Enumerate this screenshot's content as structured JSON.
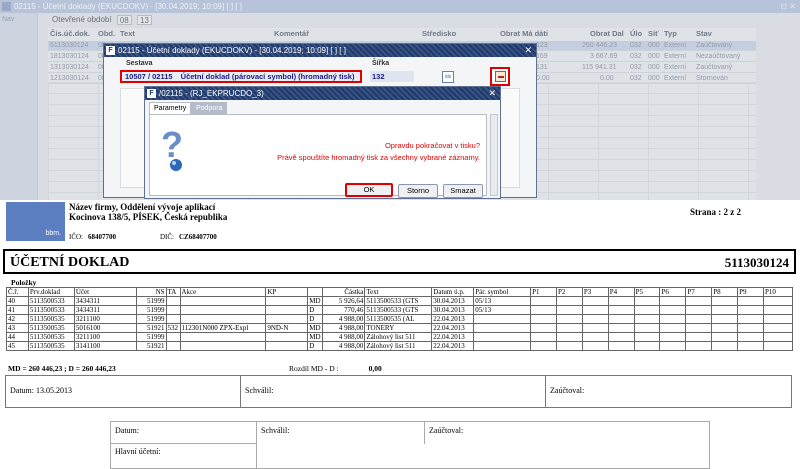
{
  "app": {
    "title": "02115 - Účetní doklady (EKUCDOKV) - [30.04.2019; 10:09] [ ] [ ]",
    "window_btns": "⊡ ✕",
    "nav_label": "Nav",
    "period_label": "Otevřené období",
    "period_values": [
      "08",
      "13"
    ],
    "grid_headers": [
      "Čís.úč.dok.",
      "Obd.",
      "Text",
      "Komentář",
      "Středisko",
      "Obrat Má dáti",
      "Obrat Dal",
      "Úlo",
      "Síť",
      "Typ",
      "Stav"
    ],
    "rows": [
      {
        "cislo": "5113030124",
        "obd": "08",
        "md": "123",
        "dal": "260 446.23",
        "ulo": "032",
        "sit": "000",
        "typ": "Externí",
        "stav": "Zaúčtovaný"
      },
      {
        "cislo": "1813030124",
        "obd": "08",
        "md": "169",
        "dal": "3 667.69",
        "ulo": "032",
        "sit": "000",
        "typ": "Externí",
        "stav": "Nezaúčtovaný"
      },
      {
        "cislo": "1313030124",
        "obd": "08",
        "md": "131",
        "dal": "115 941.31",
        "ulo": "032",
        "sit": "000",
        "typ": "Externí",
        "stav": "Zaúčtovaný"
      },
      {
        "cislo": "1213030124",
        "obd": "08",
        "md": "0.00",
        "dal": "0.00",
        "ulo": "032",
        "sit": "000",
        "typ": "Externí",
        "stav": "Stornován"
      }
    ]
  },
  "dialog1": {
    "title": "02115 - Účetní doklady (EKUCDOKV) - [30.04.2019; 10:09] [ ] [ ]",
    "close": "✕",
    "sestava_label": "Sestava",
    "sirka_label": "Šířka",
    "sestava_code": "10507 / 02115",
    "sestava_name": "Účetní doklad (párovací symbol) (hromadný tisk)",
    "sirka_value": "132",
    "excel_icon_text": "xls"
  },
  "dialog2": {
    "title": "/02115 - (RJ_EKPRUCDO_3)",
    "close": "✕",
    "tabs": [
      "Parametry",
      "Podpora"
    ],
    "message1": "Opravdu pokračovat v tisku?",
    "message2": "Právě spouštíte hromadný tisk za všechny vybrané záznamy.",
    "btn_ok": "OK",
    "btn_storno": "Storno",
    "btn_smazat": "Smazat"
  },
  "document": {
    "logo_text": "bbm.",
    "company_line1": "Název firmy, Oddělení vývoje aplikací",
    "company_line2": "Kocinova 138/5, PÍSEK, Česká republika",
    "ico_label": "IČO:",
    "ico_value": "68407700",
    "dic_label": "DIČ:",
    "dic_value": "CZ68407700",
    "strana": "Strana  :  2 z 2",
    "title": "ÚČETNÍ DOKLAD",
    "number": "5113030124",
    "polozky": "Položky",
    "headers": [
      "Č.ř.",
      "Prv.doklad",
      "Účet",
      "NS",
      "TA",
      "Akce",
      "KP",
      "",
      "Částka",
      "Text",
      "Datum ú.p.",
      "Pár. symbol",
      "P1",
      "P2",
      "P3",
      "P4",
      "P5",
      "P6",
      "P7",
      "P8",
      "P9",
      "P10"
    ],
    "rows": [
      [
        "40",
        "5113500533",
        "3434311",
        "51999",
        "",
        "",
        "",
        "MD",
        "5 926,64",
        "5113500533 (GTS",
        "30.04.2013",
        "05/13"
      ],
      [
        "41",
        "5113500533",
        "3434311",
        "51999",
        "",
        "",
        "",
        "D",
        "770,46",
        "5113500533 (GTS",
        "30.04.2013",
        "05/13"
      ],
      [
        "42",
        "5113500535",
        "3211100",
        "51999",
        "",
        "",
        "",
        "D",
        "4 988,00",
        "5113500535 (AL",
        "22.04.2013",
        ""
      ],
      [
        "43",
        "5113500535",
        "5016100",
        "51921",
        "532",
        "112301N000 ZPX-Expl",
        "9ND-N",
        "MD",
        "4 988,00",
        "TONERY",
        "22.04.2013",
        ""
      ],
      [
        "44",
        "5113500535",
        "3211100",
        "51999",
        "",
        "",
        "",
        "MD",
        "4 988,00",
        "Zálohový list 511",
        "22.04.2013",
        ""
      ],
      [
        "45",
        "5113500535",
        "3141100",
        "51921",
        "",
        "",
        "",
        "D",
        "4 988,00",
        "Zálohový list 511",
        "22.04.2013",
        ""
      ]
    ],
    "sum_line": "MD = 260 446,23 ; D = 260 446,23",
    "rozdil_label": "Rozdíl MD - D  :",
    "rozdil_value": "0,00",
    "sign1": [
      "Datum: 13.05.2013",
      "Schválil:",
      "Zaúčtoval:"
    ],
    "sign2": [
      "Datum:",
      "Schválil:",
      "Zaúčtoval:",
      "Hlavní účetní:"
    ]
  }
}
